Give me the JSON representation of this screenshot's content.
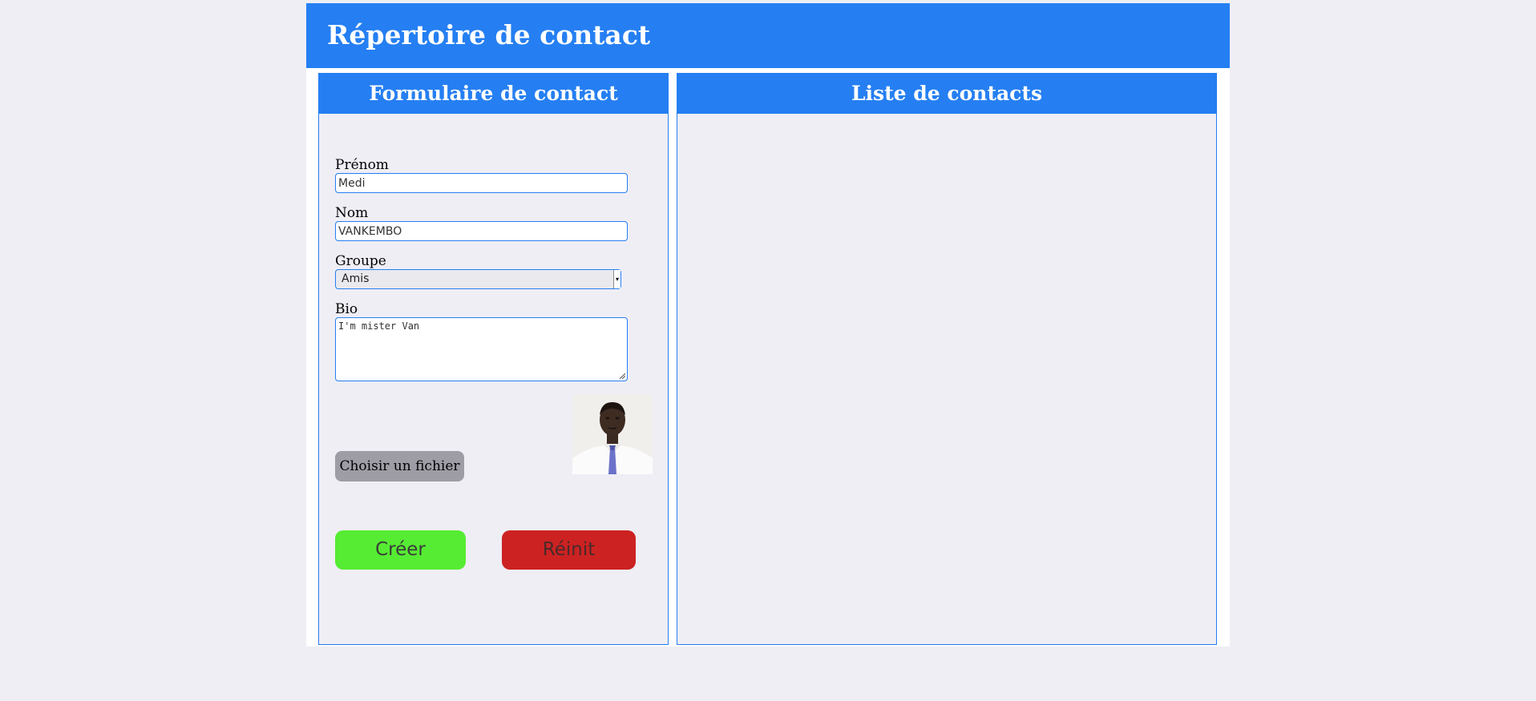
{
  "app": {
    "title": "Répertoire de contact"
  },
  "form_panel": {
    "title": "Formulaire de contact",
    "fields": {
      "first_name": {
        "label": "Prénom",
        "value": "Medi"
      },
      "last_name": {
        "label": "Nom",
        "value": "VANKEMBO"
      },
      "group": {
        "label": "Groupe",
        "value": "Amis"
      },
      "bio": {
        "label": "Bio",
        "value": "I'm mister Van"
      }
    },
    "file_button_label": "Choisir un fichier",
    "photo": {
      "icon": "contact-photo"
    },
    "create_button_label": "Créer",
    "reset_button_label": "Réinit"
  },
  "list_panel": {
    "title": "Liste de contacts",
    "contacts": []
  },
  "colors": {
    "accent": "#257ff2",
    "background": "#efeef5",
    "create_button": "#56ec33",
    "reset_button": "#cc2222",
    "file_button": "#9e9da6"
  }
}
